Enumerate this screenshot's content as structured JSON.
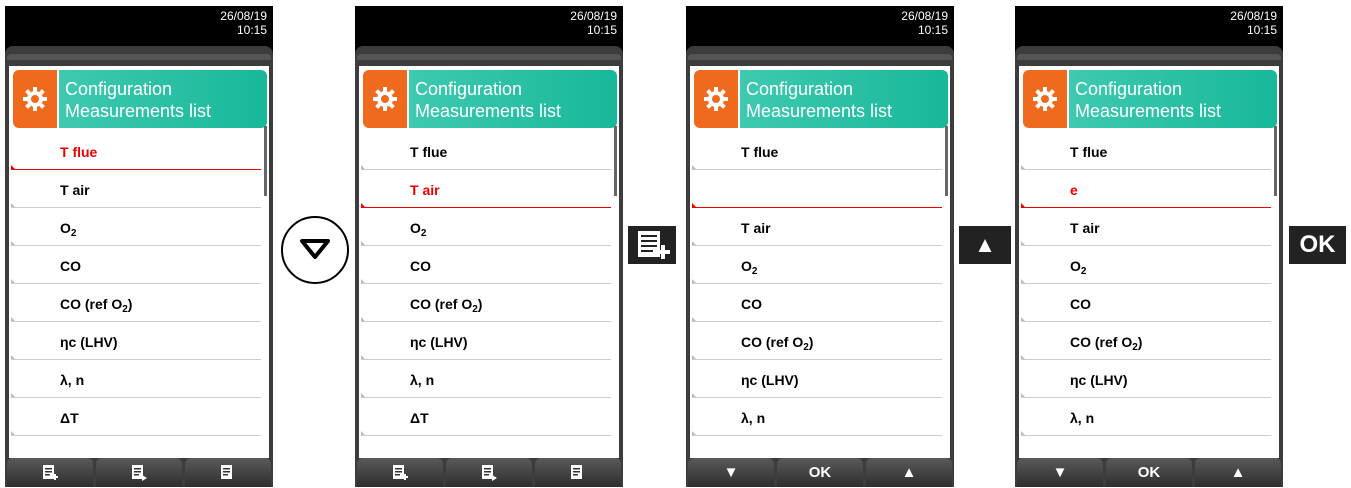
{
  "screens": [
    {
      "date": "26/08/19",
      "time": "10:15",
      "title_line1": "Configuration",
      "title_line2": "Measurements list",
      "items": [
        "T flue",
        "T air",
        "O2",
        "CO",
        "CO (ref O2)",
        "ηc (LHV)",
        "λ, n",
        "ΔT"
      ],
      "selected": 0,
      "buttons": [
        "add-list-icon",
        "edit-list-icon",
        "list-icon"
      ]
    },
    {
      "date": "26/08/19",
      "time": "10:15",
      "title_line1": "Configuration",
      "title_line2": "Measurements list",
      "items": [
        "T flue",
        "T air",
        "O2",
        "CO",
        "CO (ref O2)",
        "ηc (LHV)",
        "λ, n",
        "ΔT"
      ],
      "selected": 1,
      "buttons": [
        "add-list-icon",
        "edit-list-icon",
        "list-icon"
      ]
    },
    {
      "date": "26/08/19",
      "time": "10:15",
      "title_line1": "Configuration",
      "title_line2": "Measurements list",
      "items": [
        "T flue",
        "",
        "T air",
        "O2",
        "CO",
        "CO (ref O2)",
        "ηc (LHV)",
        "λ, n"
      ],
      "selected": 1,
      "buttons": [
        "▼",
        "OK",
        "▲"
      ]
    },
    {
      "date": "26/08/19",
      "time": "10:15",
      "title_line1": "Configuration",
      "title_line2": "Measurements list",
      "items": [
        "T flue",
        "e",
        "T air",
        "O2",
        "CO",
        "CO (ref O2)",
        "ηc (LHV)",
        "λ, n"
      ],
      "selected": 1,
      "buttons": [
        "▼",
        "OK",
        "▲"
      ]
    }
  ],
  "connectors": {
    "down_key": "down-triangle-icon",
    "add_key": "add-list-icon",
    "up_key": "▲",
    "ok_key": "OK"
  }
}
